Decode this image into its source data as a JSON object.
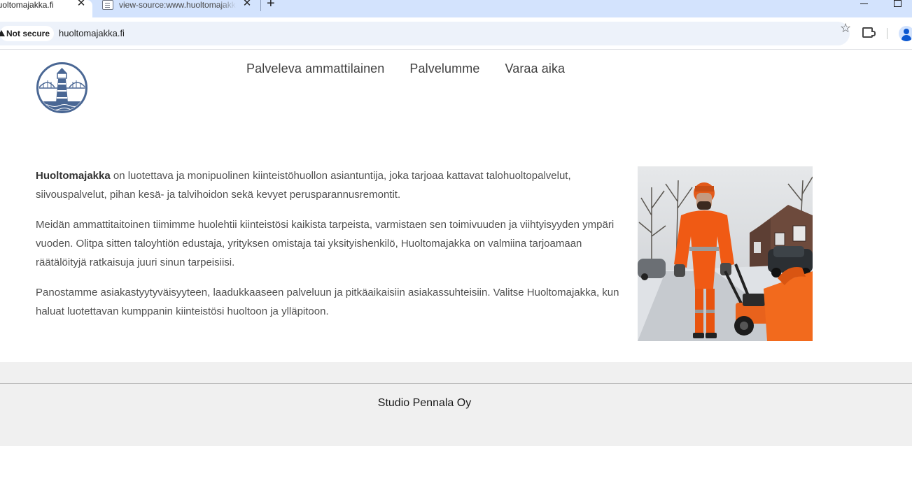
{
  "browser": {
    "active_tab_title": "huoltomajakka.fi",
    "inactive_tab_title": "view-source:www.huoltomajakka.fi",
    "security_label": "Not secure",
    "url": "huoltomajakka.fi"
  },
  "nav": {
    "items": [
      {
        "label": "Palveleva ammattilainen"
      },
      {
        "label": "Palvelumme"
      },
      {
        "label": "Varaa aika"
      }
    ]
  },
  "content": {
    "brand": "Huoltomajakka",
    "p1_rest": " on luotettava ja monipuolinen kiinteistöhuollon asiantuntija, joka tarjoaa kattavat talohuoltopalvelut, siivouspalvelut, pihan kesä- ja talvihoidon sekä kevyet perusparannusremontit.",
    "p2": "Meidän ammattitaitoinen tiimimme huolehtii kiinteistösi kaikista tarpeista, varmistaen sen toimivuuden ja viihtyisyyden ympäri vuoden. Olitpa sitten taloyhtiön edustaja, yrityksen omistaja tai yksityishenkilö, Huoltomajakka on valmiina tarjoamaan räätälöityjä ratkaisuja juuri sinun tarpeisiisi.",
    "p3": "Panostamme asiakastyytyväisyyteen, laadukkaaseen palveluun ja pitkäaikaisiin asiakassuhteisiin. Valitse Huoltomajakka, kun haluat luotettavan kumppanin kiinteistösi huoltoon ja ylläpitoon."
  },
  "footer": {
    "text": "Studio Pennala Oy"
  },
  "icons": {
    "tab_close": "close-icon",
    "new_tab": "plus-icon",
    "bookmark": "star-icon",
    "extensions": "puzzle-icon",
    "profile": "person-icon"
  },
  "colors": {
    "tabbar": "#d3e3fd",
    "logo": "#4a6794",
    "footer_bg": "#f0f0f0",
    "orange": "#f05a14"
  }
}
